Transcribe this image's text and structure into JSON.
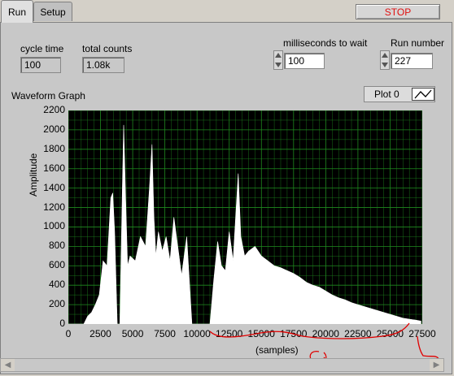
{
  "tabs": [
    {
      "label": "Run"
    },
    {
      "label": "Setup"
    }
  ],
  "stop_label": "STOP",
  "controls": {
    "cycle_time": {
      "label": "cycle time",
      "value": "100"
    },
    "total_counts": {
      "label": "total counts",
      "value": "1.08k"
    },
    "ms_wait": {
      "label": "milliseconds to wait",
      "value": "100"
    },
    "run_number": {
      "label": "Run number",
      "value": "227"
    }
  },
  "graph": {
    "title": "Waveform Graph",
    "legend_label": "Plot 0",
    "ylabel": "Amplitude",
    "xlabel": "(samples)",
    "yticks": [
      "2200",
      "2000",
      "1800",
      "1600",
      "1400",
      "1200",
      "1000",
      "800",
      "600",
      "400",
      "200",
      "0"
    ],
    "xticks": [
      "0",
      "2500",
      "5000",
      "7500",
      "10000",
      "12500",
      "15000",
      "17500",
      "20000",
      "22500",
      "25000",
      "27500"
    ]
  },
  "colors": {
    "plot_bg": "#000000",
    "grid": "#1f8a1f",
    "trace": "#ffffff",
    "stop_text": "#e01010",
    "annotation": "#e00000"
  },
  "chart_data": {
    "type": "area",
    "xlabel": "(samples)",
    "ylabel": "Amplitude",
    "xlim": [
      0,
      27500
    ],
    "ylim": [
      0,
      2200
    ],
    "grid": true,
    "x": [
      0,
      1200,
      1500,
      1800,
      2100,
      2400,
      2700,
      3000,
      3300,
      3450,
      3600,
      3800,
      4000,
      4200,
      4300,
      4450,
      4600,
      4800,
      5200,
      5600,
      6000,
      6300,
      6500,
      6650,
      6800,
      7000,
      7300,
      7600,
      7900,
      8200,
      8500,
      8800,
      9200,
      9600,
      9700,
      10000,
      10500,
      11000,
      11300,
      11600,
      11900,
      12200,
      12500,
      12800,
      13000,
      13200,
      13400,
      13700,
      14000,
      14500,
      15000,
      15500,
      16000,
      16500,
      17000,
      17500,
      18000,
      18500,
      19000,
      19500,
      20000,
      20500,
      21000,
      21500,
      22000,
      22500,
      23000,
      23500,
      24000,
      24500,
      25000,
      25500,
      26000,
      26500,
      27000,
      27400
    ],
    "y": [
      0,
      0,
      80,
      120,
      200,
      300,
      650,
      600,
      1300,
      1350,
      950,
      0,
      0,
      1400,
      2050,
      1300,
      600,
      700,
      650,
      900,
      800,
      1400,
      1850,
      1100,
      700,
      950,
      750,
      900,
      650,
      1100,
      800,
      500,
      900,
      0,
      0,
      0,
      0,
      0,
      450,
      850,
      600,
      550,
      950,
      650,
      1100,
      1550,
      900,
      700,
      750,
      800,
      700,
      650,
      600,
      580,
      550,
      520,
      480,
      430,
      400,
      380,
      340,
      300,
      270,
      250,
      220,
      200,
      180,
      160,
      140,
      120,
      100,
      80,
      60,
      50,
      40,
      30
    ],
    "annotation": "hand-drawn red curve below the x-axis"
  }
}
